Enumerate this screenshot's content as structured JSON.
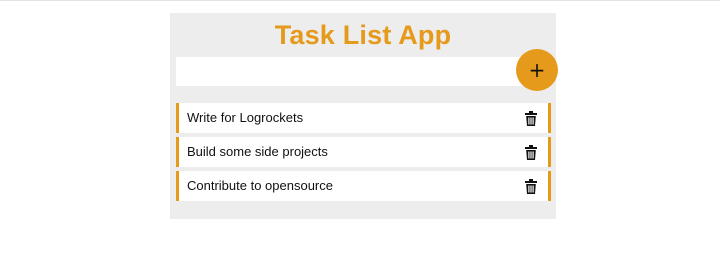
{
  "app": {
    "title": "Task List App",
    "input": {
      "value": "",
      "placeholder": ""
    },
    "add_button": {
      "label": "+",
      "color": "#e59a1c"
    },
    "accent_color": "#e59a1c"
  },
  "tasks": [
    {
      "text": "Write for Logrockets",
      "action_icon": "trash-icon"
    },
    {
      "text": "Build some side projects",
      "action_icon": "trash-icon"
    },
    {
      "text": "Contribute to opensource",
      "action_icon": "trash-icon"
    }
  ]
}
